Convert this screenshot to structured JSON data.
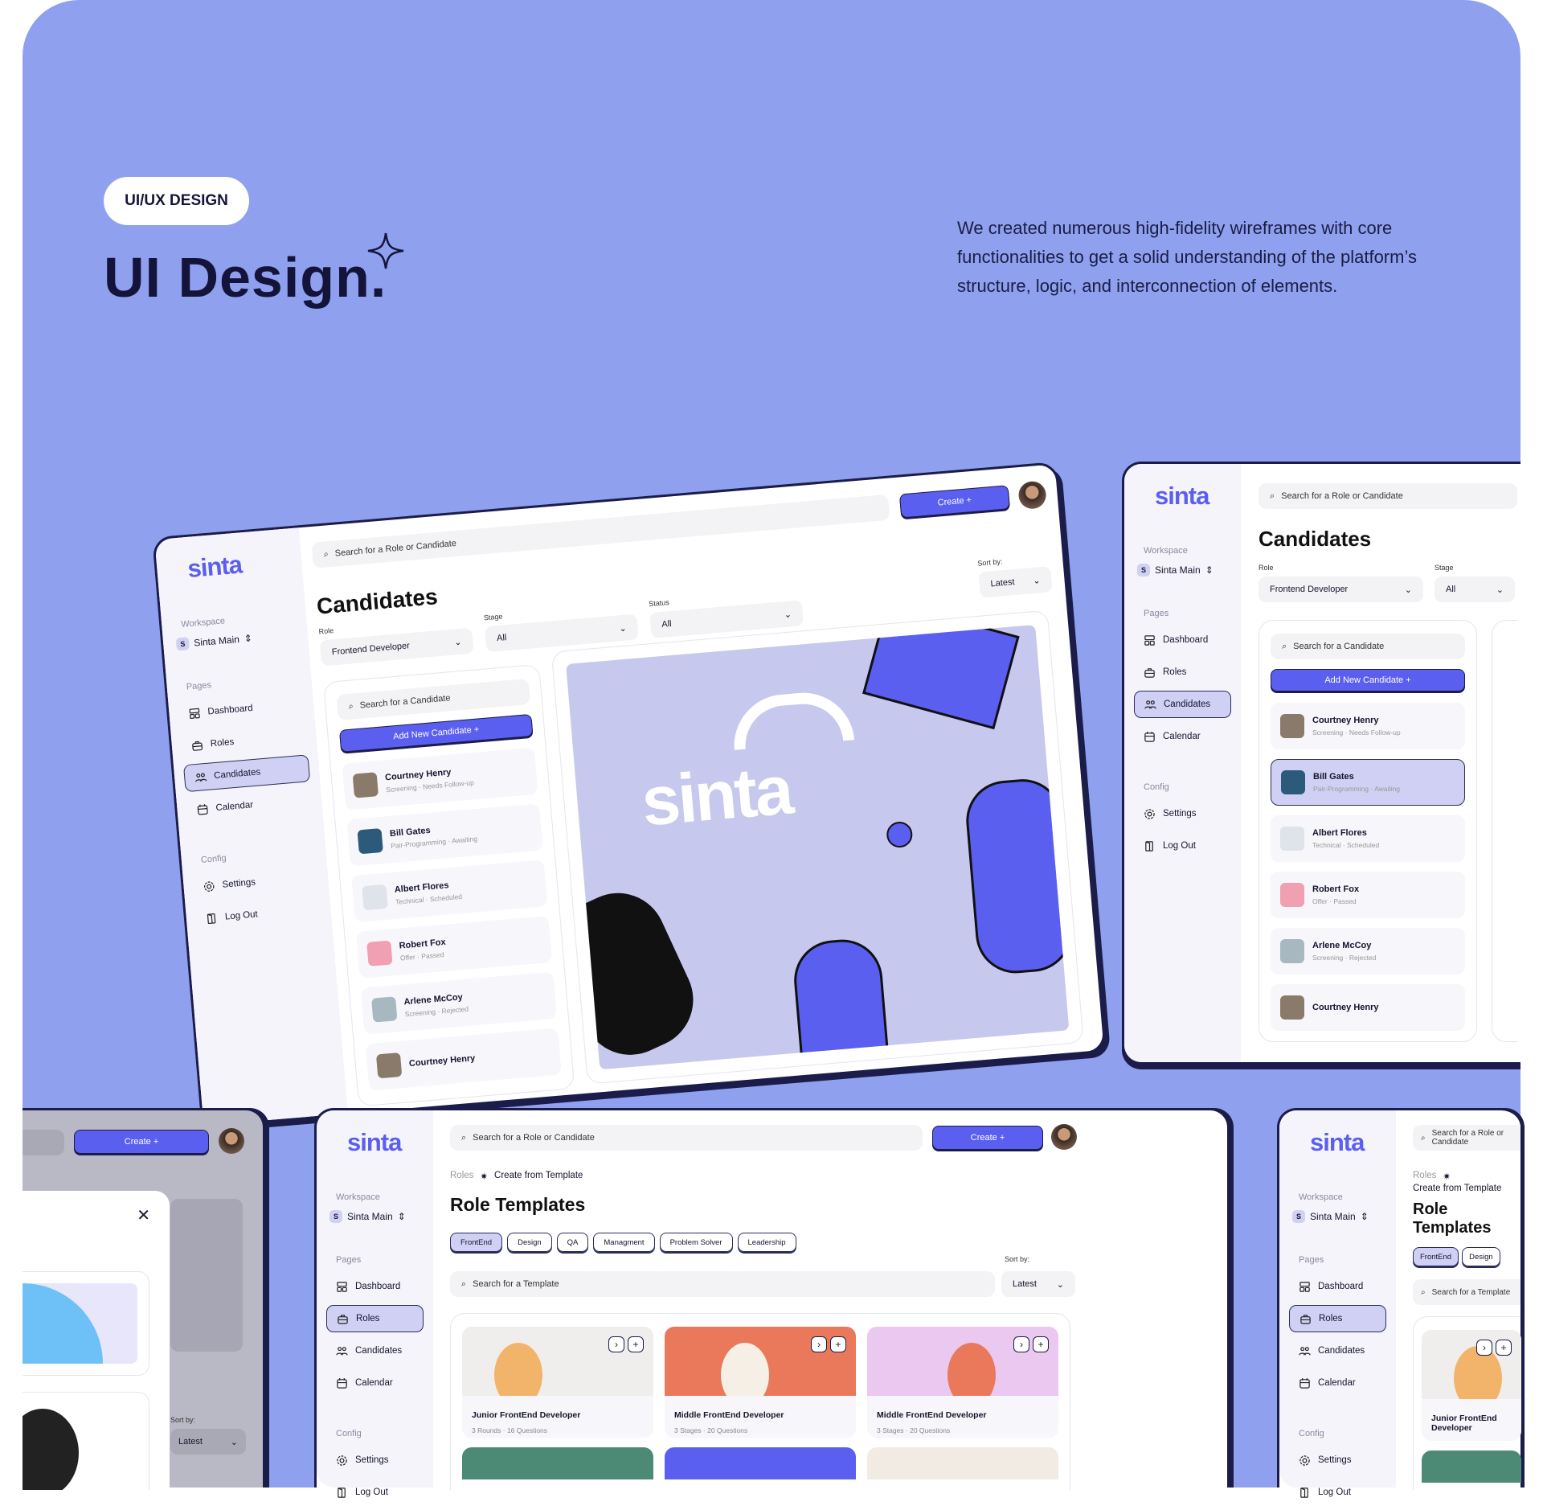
{
  "header": {
    "badge": "UI/UX DESIGN",
    "title": "UI Design.",
    "description": "We created numerous high-fidelity wireframes with core functionalities to get a solid understanding of the platform’s structure, logic, and interconnection of elements."
  },
  "sidebar": {
    "logo": "sinta",
    "workspace_label": "Workspace",
    "workspace_initial": "S",
    "workspace_name": "Sinta Main",
    "pages_label": "Pages",
    "items": [
      {
        "label": "Dashboard",
        "icon": "dashboard-icon"
      },
      {
        "label": "Roles",
        "icon": "briefcase-icon"
      },
      {
        "label": "Candidates",
        "icon": "users-icon"
      },
      {
        "label": "Calendar",
        "icon": "calendar-icon"
      }
    ],
    "config_label": "Config",
    "config_items": [
      {
        "label": "Settings",
        "icon": "gear-icon"
      },
      {
        "label": "Log Out",
        "icon": "logout-icon"
      }
    ]
  },
  "topbar": {
    "search_placeholder": "Search for a Role or Candidate",
    "create_label": "Create +"
  },
  "candidates_screen": {
    "title": "Candidates",
    "filters": [
      {
        "label": "Role",
        "value": "Frontend Developer"
      },
      {
        "label": "Stage",
        "value": "All"
      },
      {
        "label": "Status",
        "value": "All"
      }
    ],
    "sort_label": "Sort by:",
    "sort_value": "Latest",
    "candidate_search": "Search for a Candidate",
    "add_button": "Add New Candidate +",
    "illustration_text": "sinta",
    "candidates": [
      {
        "name": "Courtney Henry",
        "stage": "Screening",
        "status": "Needs Follow-up",
        "photo": "#8a7a6a"
      },
      {
        "name": "Bill Gates",
        "stage": "Pair-Programming",
        "status": "Awaiting",
        "photo": "#2c5a7a"
      },
      {
        "name": "Albert Flores",
        "stage": "Technical",
        "status": "Scheduled",
        "photo": "#dfe3ea"
      },
      {
        "name": "Robert Fox",
        "stage": "Offer",
        "status": "Passed",
        "photo": "#f0a0b0"
      },
      {
        "name": "Arlene McCoy",
        "stage": "Screening",
        "status": "Rejected",
        "photo": "#a8b8c0"
      },
      {
        "name": "Courtney Henry",
        "stage": "",
        "status": "",
        "photo": "#8a7a6a"
      }
    ]
  },
  "templates_screen": {
    "breadcrumb_root": "Roles",
    "breadcrumb_current": "Create from Template",
    "title": "Role Templates",
    "chips": [
      "FrontEnd",
      "Design",
      "QA",
      "Managment",
      "Problem Solver",
      "Leadership"
    ],
    "search_placeholder": "Search for a Template",
    "sort_label": "Sort by:",
    "sort_value": "Latest",
    "templates": [
      {
        "title": "Junior FrontEnd Developer",
        "meta": "3 Rounds · 16 Questions",
        "color": "#efeeec"
      },
      {
        "title": "Middle FrontEnd Developer",
        "meta": "3 Stages · 20 Questions",
        "color": "#e9795a"
      },
      {
        "title": "Middle FrontEnd Developer",
        "meta": "3 Stages · 20 Questions",
        "color": "#eac8ef"
      }
    ]
  },
  "colors": {
    "background": "#8fa0ef",
    "accent": "#5b5ff0",
    "active": "#cfd0f3",
    "outline": "#1b1c4a"
  }
}
